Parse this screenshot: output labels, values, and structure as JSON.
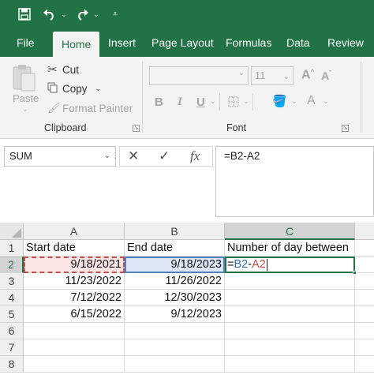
{
  "qat": {
    "save_icon": "save-icon",
    "undo_icon": "undo-icon",
    "redo_icon": "redo-icon"
  },
  "tabs": [
    "File",
    "Home",
    "Insert",
    "Page Layout",
    "Formulas",
    "Data",
    "Review"
  ],
  "active_tab": "Home",
  "ribbon": {
    "clipboard": {
      "paste": "Paste",
      "cut": "Cut",
      "copy": "Copy",
      "format_painter": "Format Painter",
      "label": "Clipboard"
    },
    "font": {
      "font_name": "",
      "font_size": "11",
      "bold": "B",
      "italic": "I",
      "underline": "U",
      "font_color_letter": "A",
      "grow_letter": "A",
      "shrink_letter": "A",
      "label": "Font"
    }
  },
  "formula_bar": {
    "name_box": "SUM",
    "cancel": "✕",
    "enter": "✓",
    "fx": "fx",
    "formula": "=B2-A2"
  },
  "grid": {
    "columns": [
      "A",
      "B",
      "C"
    ],
    "rows": [
      "1",
      "2",
      "3",
      "4",
      "5",
      "6",
      "7",
      "8"
    ],
    "cells": {
      "A1": "Start date",
      "B1": "End date",
      "C1": "Number of day between",
      "A2": "9/18/2021",
      "B2": "9/18/2023",
      "A3": "11/23/2022",
      "B3": "11/26/2022",
      "A4": "7/12/2022",
      "B4": "12/30/2023",
      "A5": "6/15/2022",
      "B5": "9/12/2023"
    },
    "active_cell_formula": {
      "eq": "=",
      "ref1": "B2",
      "op": "-",
      "ref2": "A2"
    }
  },
  "colors": {
    "excel_green": "#217346",
    "ref_blue": "#4f81bd",
    "ref_red": "#c0504d"
  }
}
